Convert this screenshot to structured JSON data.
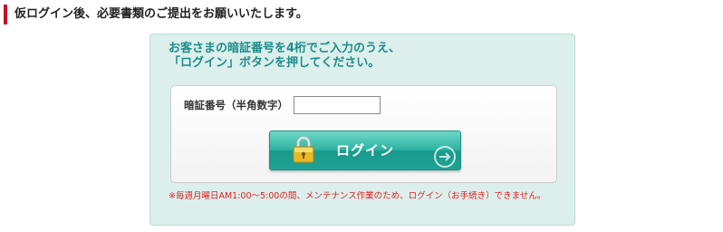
{
  "section": {
    "heading": "仮ログイン後、必要書類のご提出をお願いいたします。"
  },
  "login": {
    "instruction_line1": "お客さまの暗証番号を4桁でご入力のうえ、",
    "instruction_line2": "「ログイン」ボタンを押してください。",
    "pin_label": "暗証番号（半角数字）",
    "pin_value": "",
    "button_label": "ログイン",
    "maintenance_note": "※毎週月曜日AM1:00～5:00の間、メンテナンス作業のため、ログイン（お手続き）できません。"
  },
  "icons": {
    "button_left": "padlock-icon",
    "button_right": "arrow-circle-icon"
  },
  "colors": {
    "heading_accent": "#c8102e",
    "panel_bg": "#dcefec",
    "instruction_text": "#1d8c8b",
    "button_teal": "#2db3a3",
    "note_red": "#e02020"
  }
}
